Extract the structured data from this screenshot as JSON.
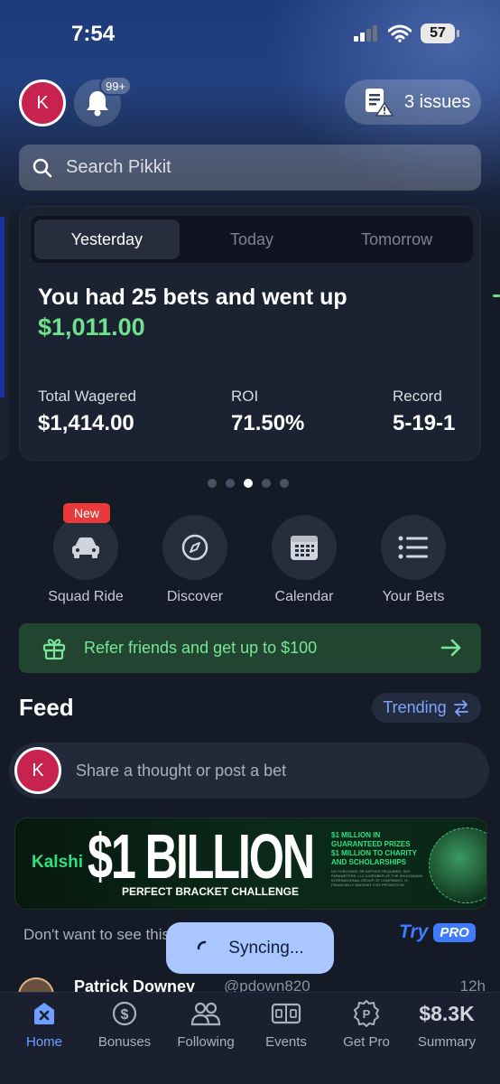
{
  "status_bar": {
    "time": "7:54",
    "battery": "57"
  },
  "header": {
    "avatar_initial": "K",
    "notification_count": "99+",
    "issues_label": "3 issues"
  },
  "search": {
    "placeholder": "Search Pikkit"
  },
  "summary": {
    "tabs": [
      "Yesterday",
      "Today",
      "Tomorrow"
    ],
    "active_tab": "Yesterday",
    "headline": "You had 25 bets and went up",
    "amount": "$1,011.00",
    "stats": [
      {
        "label": "Total Wagered",
        "value": "$1,414.00"
      },
      {
        "label": "ROI",
        "value": "71.50%"
      },
      {
        "label": "Record",
        "value": "5-19-1"
      }
    ],
    "pages_total": 5,
    "page_active": 3,
    "accent_color": "#6ee38c"
  },
  "quick_actions": {
    "new_badge": "New",
    "items": [
      {
        "label": "Squad Ride",
        "icon": "car-icon"
      },
      {
        "label": "Discover",
        "icon": "compass-icon"
      },
      {
        "label": "Calendar",
        "icon": "calendar-icon"
      },
      {
        "label": "Your Bets",
        "icon": "list-icon"
      }
    ]
  },
  "referral": {
    "text": "Refer friends and get up to $100"
  },
  "feed": {
    "title": "Feed",
    "trending_label": "Trending",
    "compose_avatar": "K",
    "compose_placeholder": "Share a thought or post a bet"
  },
  "ad_banner": {
    "brand": "Kalshi",
    "headline": "$1 BILLION",
    "subheadline": "PERFECT BRACKET CHALLENGE",
    "prize_line_1": "$1 MILLION IN GUARANTEED PRIZES",
    "prize_line_2": "$1 MILLION TO CHARITY AND SCHOLARSHIPS",
    "fine_print": "NO PURCHASE OR DEPOSIT REQUIRED. SEE PARAMETERS. LLC A MEMBER OF THE SHUGAKAWA INTERNATIONAL GROUP OF COMPANIES. IS FINANCIALLY BACKING THIS PROMOTION."
  },
  "upsell": {
    "text": "Don't want to see this",
    "try_label": "Try",
    "pro_label": "PRO"
  },
  "toast": {
    "text": "Syncing..."
  },
  "post_preview": {
    "name": "Patrick Downey",
    "handle": "@pdown820",
    "time": "12h"
  },
  "tab_bar": {
    "items": [
      {
        "label": "Home",
        "icon": "home-icon",
        "active": true
      },
      {
        "label": "Bonuses",
        "icon": "dollar-coin-icon"
      },
      {
        "label": "Following",
        "icon": "people-icon"
      },
      {
        "label": "Events",
        "icon": "scoreboard-icon"
      },
      {
        "label": "Get Pro",
        "icon": "pro-coin-icon"
      },
      {
        "label": "Summary",
        "value": "$8.3K"
      }
    ],
    "active_color": "#6fa0ff"
  }
}
